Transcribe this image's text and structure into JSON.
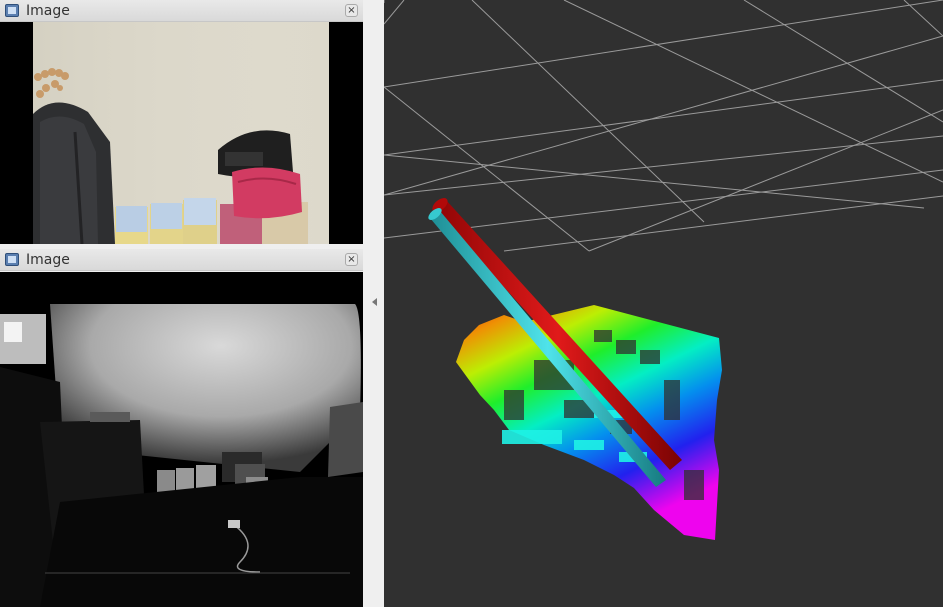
{
  "panels": [
    {
      "title": "Image",
      "close": "×"
    },
    {
      "title": "Image",
      "close": "×"
    }
  ],
  "colors": {
    "rviz_background": "#303030",
    "grid_line": "#9a9a9a",
    "arrow_red": "#c40d0d",
    "arrow_cyan": "#29c1c8"
  }
}
